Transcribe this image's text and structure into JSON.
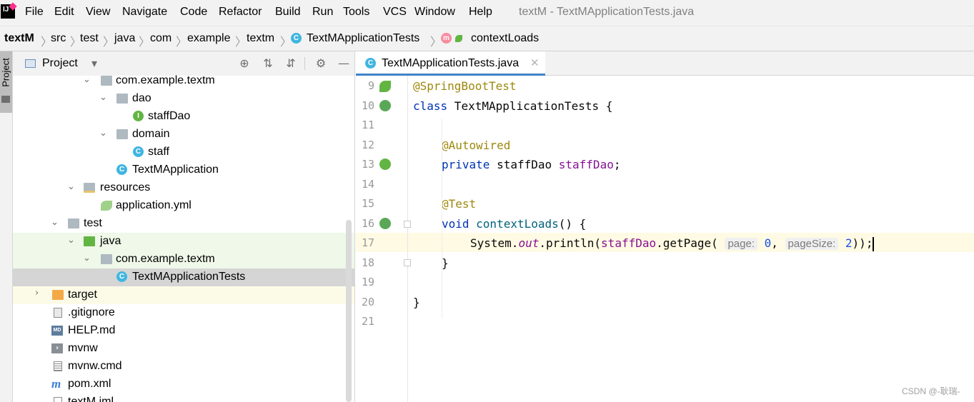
{
  "menu": {
    "items": [
      "File",
      "Edit",
      "View",
      "Navigate",
      "Code",
      "Refactor",
      "Build",
      "Run",
      "Tools",
      "VCS",
      "Window",
      "Help"
    ],
    "window_title": "textM - TextMApplicationTests.java"
  },
  "breadcrumb": {
    "items": [
      "textM",
      "src",
      "test",
      "java",
      "com",
      "example",
      "textm",
      "TextMApplicationTests",
      "contextLoads"
    ]
  },
  "tool_strip": {
    "project_label": "Project"
  },
  "project_panel": {
    "title": "Project",
    "tree": [
      {
        "label": "com.example.textm",
        "icon": "package-icon",
        "expanded": true
      },
      {
        "label": "dao",
        "icon": "package-icon",
        "expanded": true
      },
      {
        "label": "staffDao",
        "icon": "interface-icon"
      },
      {
        "label": "domain",
        "icon": "package-icon",
        "expanded": true
      },
      {
        "label": "staff",
        "icon": "class-icon"
      },
      {
        "label": "TextMApplication",
        "icon": "spring-class-icon"
      },
      {
        "label": "resources",
        "icon": "resources-folder-icon",
        "expanded": true
      },
      {
        "label": "application.yml",
        "icon": "yaml-icon"
      },
      {
        "label": "test",
        "icon": "folder-icon",
        "expanded": true
      },
      {
        "label": "java",
        "icon": "test-source-folder-icon",
        "expanded": true
      },
      {
        "label": "com.example.textm",
        "icon": "package-icon",
        "expanded": true
      },
      {
        "label": "TextMApplicationTests",
        "icon": "spring-class-icon",
        "selected": true
      },
      {
        "label": "target",
        "icon": "excluded-folder-icon",
        "expanded": false
      },
      {
        "label": ".gitignore",
        "icon": "gitignore-icon"
      },
      {
        "label": "HELP.md",
        "icon": "markdown-icon"
      },
      {
        "label": "mvnw",
        "icon": "shell-icon"
      },
      {
        "label": "mvnw.cmd",
        "icon": "text-file-icon"
      },
      {
        "label": "pom.xml",
        "icon": "maven-icon"
      },
      {
        "label": "textM.iml",
        "icon": "iml-icon"
      }
    ]
  },
  "editor": {
    "tab_label": "TextMApplicationTests.java",
    "line_numbers": [
      "9",
      "10",
      "11",
      "12",
      "13",
      "14",
      "15",
      "16",
      "17",
      "18",
      "19",
      "20",
      "21"
    ],
    "code": {
      "l9_annotation": "@SpringBootTest",
      "l10_keyword": "class",
      "l10_rest": " TextMApplicationTests {",
      "l12_annotation": "@Autowired",
      "l13_keyword": "private",
      "l13_type": " staffDao ",
      "l13_field": "staffDao",
      "l13_end": ";",
      "l15_annotation": "@Test",
      "l16_keyword": "void",
      "l16_method": " contextLoads",
      "l16_rest": "() {",
      "l17_a": "System.",
      "l17_out": "out",
      "l17_b": ".println(",
      "l17_field": "staffDao",
      "l17_c": ".getPage(",
      "l17_hint1": "page:",
      "l17_num1": "0",
      "l17_sep": ", ",
      "l17_hint2": "pageSize:",
      "l17_num2": "2",
      "l17_end": "));",
      "l18": "}",
      "l20": "}"
    }
  },
  "watermark": "CSDN @-耿瑞-",
  "colors": {
    "keyword": "#0033b3",
    "annotation": "#9e880d",
    "field": "#871094",
    "number": "#1750eb",
    "selection": "#d5d5d5",
    "caret_line": "#fffae3",
    "test_root_highlight": "#eff8e9"
  }
}
